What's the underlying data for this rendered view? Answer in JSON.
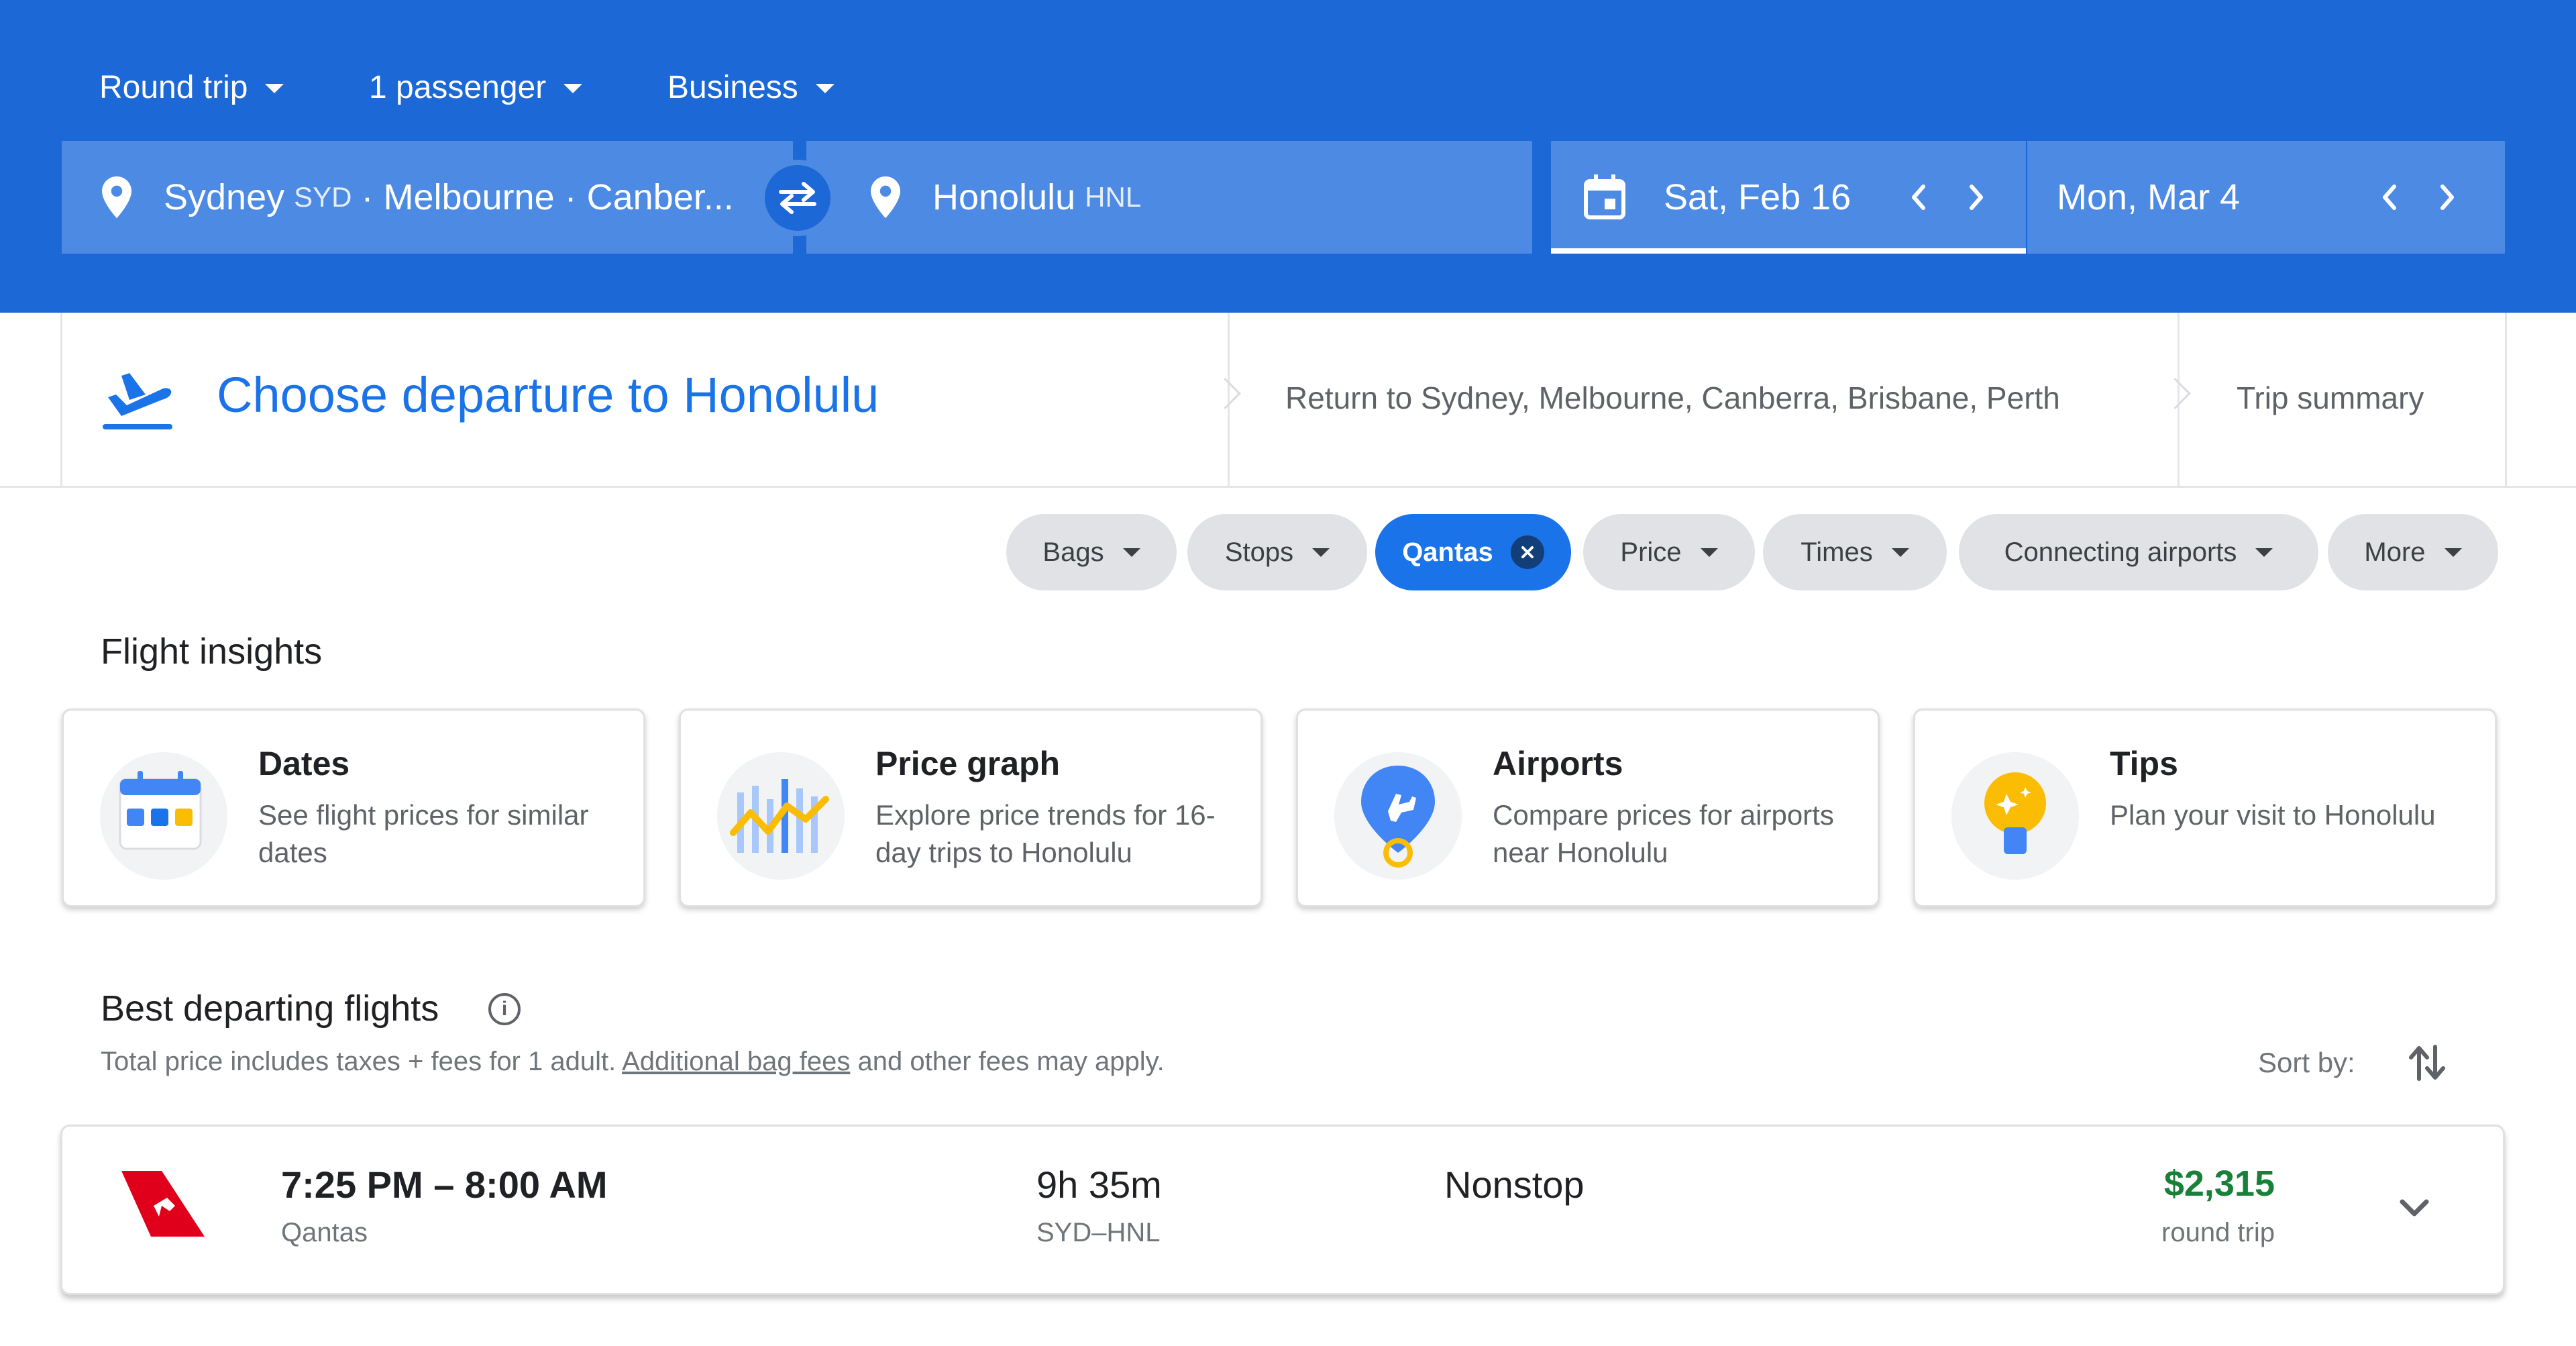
{
  "header": {
    "trip_type": "Round trip",
    "passengers": "1 passenger",
    "cabin": "Business",
    "origin": {
      "city": "Sydney",
      "code": "SYD",
      "others": "· Melbourne · Canber..."
    },
    "destination": {
      "city": "Honolulu",
      "code": "HNL"
    },
    "depart_date": "Sat, Feb 16",
    "return_date": "Mon, Mar 4"
  },
  "steps": {
    "active": "Choose departure to Honolulu",
    "return": "Return to Sydney, Melbourne, Canberra, Brisbane, Perth",
    "summary": "Trip summary"
  },
  "filters": [
    {
      "label": "Bags",
      "active": false
    },
    {
      "label": "Stops",
      "active": false
    },
    {
      "label": "Qantas",
      "active": true
    },
    {
      "label": "Price",
      "active": false
    },
    {
      "label": "Times",
      "active": false
    },
    {
      "label": "Connecting airports",
      "active": false
    },
    {
      "label": "More",
      "active": false
    }
  ],
  "insights": {
    "title": "Flight insights",
    "cards": [
      {
        "title": "Dates",
        "desc": "See flight prices for similar dates",
        "icon": "calendar-icon"
      },
      {
        "title": "Price graph",
        "desc": "Explore price trends for 16-day trips to Honolulu",
        "icon": "price-graph-icon"
      },
      {
        "title": "Airports",
        "desc": "Compare prices for airports near Honolulu",
        "icon": "airport-pin-icon"
      },
      {
        "title": "Tips",
        "desc": "Plan your visit to Honolulu",
        "icon": "lightbulb-icon"
      }
    ]
  },
  "best": {
    "title": "Best departing flights",
    "note_prefix": "Total price includes taxes + fees for 1 adult. ",
    "note_link": "Additional bag fees",
    "note_suffix": " and other fees may apply.",
    "sort_label": "Sort by:"
  },
  "flights": [
    {
      "times": "7:25 PM – 8:00 AM",
      "airline": "Qantas",
      "duration": "9h 35m",
      "route": "SYD–HNL",
      "stops": "Nonstop",
      "price": "$2,315",
      "price_type": "round trip"
    }
  ],
  "colors": {
    "header_bg": "#1c68d6",
    "field_bg": "#4d8ae3",
    "accent": "#1a73e8",
    "price_green": "#188038",
    "qantas_red": "#e0001b"
  }
}
